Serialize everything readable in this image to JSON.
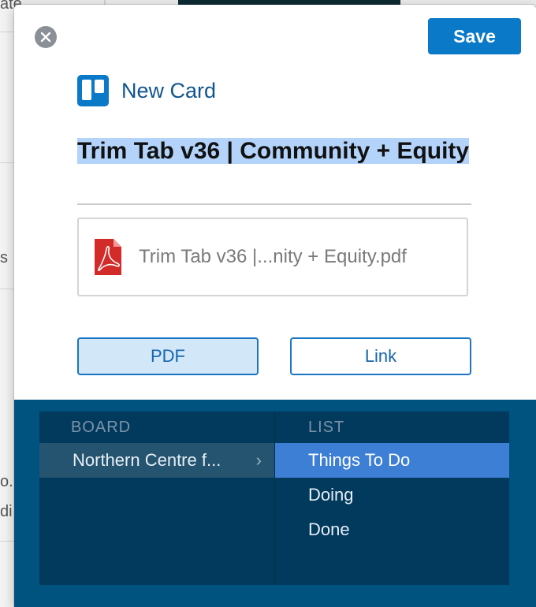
{
  "header": {
    "title": "New Card"
  },
  "toolbar": {
    "save_label": "Save"
  },
  "card": {
    "title": "Trim Tab v36 | Community + Equity"
  },
  "attachment": {
    "filename": "Trim Tab v36 |...nity + Equity.pdf"
  },
  "attach_mode": {
    "pdf_label": "PDF",
    "link_label": "Link",
    "selected": "PDF"
  },
  "picker": {
    "board_header": "BOARD",
    "list_header": "LIST",
    "boards": [
      {
        "label": "Northern Centre f...",
        "selected": true
      }
    ],
    "lists": [
      {
        "label": "Things To Do",
        "selected": true
      },
      {
        "label": "Doing",
        "selected": false
      },
      {
        "label": "Done",
        "selected": false
      }
    ]
  },
  "background": {
    "left_fragments": [
      "ate",
      "s",
      "o.",
      "di"
    ]
  },
  "colors": {
    "accent": "#0a79c8",
    "picker_bg": "#00527f",
    "picker_panel": "#023a5e",
    "list_selected": "#3e7fd6",
    "text_highlight": "#b3d3fb"
  }
}
